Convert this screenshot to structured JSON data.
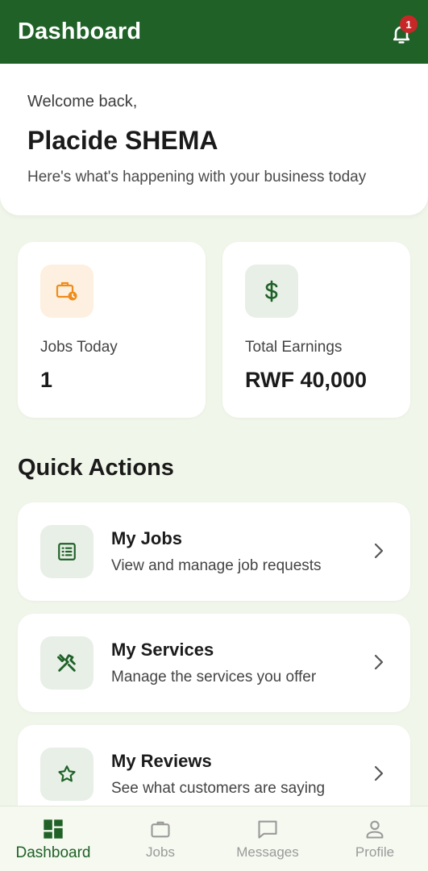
{
  "header": {
    "title": "Dashboard",
    "notification_count": "1"
  },
  "welcome": {
    "greeting": "Welcome back,",
    "name": "Placide SHEMA",
    "subtitle": "Here's what's happening with your business today"
  },
  "stats": [
    {
      "icon": "briefcase-clock-icon",
      "label": "Jobs Today",
      "value": "1"
    },
    {
      "icon": "dollar-icon",
      "label": "Total Earnings",
      "value": "RWF 40,000"
    }
  ],
  "quick_actions": {
    "title": "Quick Actions",
    "items": [
      {
        "icon": "list-icon",
        "title": "My Jobs",
        "description": "View and manage job requests"
      },
      {
        "icon": "tools-icon",
        "title": "My Services",
        "description": "Manage the services you offer"
      },
      {
        "icon": "star-icon",
        "title": "My Reviews",
        "description": "See what customers are saying"
      }
    ]
  },
  "bottom_nav": {
    "active": "Dashboard",
    "items": [
      {
        "icon": "dashboard-icon",
        "label": "Dashboard"
      },
      {
        "icon": "briefcase-icon",
        "label": "Jobs"
      },
      {
        "icon": "message-icon",
        "label": "Messages"
      },
      {
        "icon": "person-icon",
        "label": "Profile"
      }
    ]
  },
  "colors": {
    "primary": "#1f6127",
    "background": "#f1f6ea",
    "badge": "#c62828",
    "orange_accent": "#f08c1b"
  }
}
